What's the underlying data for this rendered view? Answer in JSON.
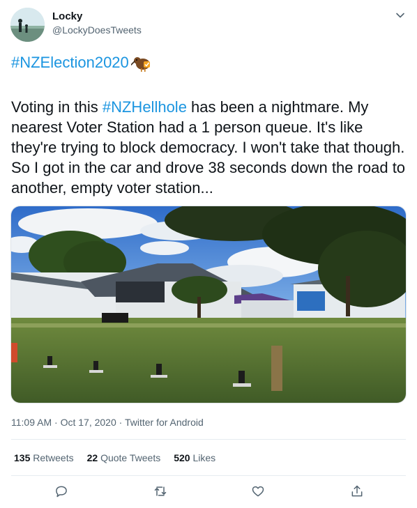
{
  "tweet": {
    "author_name": "Locky",
    "author_handle": "@LockyDoesTweets",
    "hashtag_line": "#NZElection2020",
    "body_pre": "Voting in this ",
    "body_tag": "#NZHellhole",
    "body_post": " has been a nightmare. My nearest Voter Station had a 1 person queue. It's like they're trying to block democracy. I won't take that though. So I got in the car and drove 38 seconds down the road to another, empty voter station...",
    "time": "11:09 AM",
    "date": "Oct 17, 2020",
    "source": "Twitter for Android",
    "sep": "·"
  },
  "stats": {
    "retweets_count": "135",
    "retweets_label": "Retweets",
    "quotes_count": "22",
    "quotes_label": "Quote Tweets",
    "likes_count": "520",
    "likes_label": "Likes"
  },
  "icons": {
    "reply": "reply-icon",
    "retweet": "retweet-icon",
    "like": "heart-icon",
    "share": "share-icon",
    "more": "chevron-down-icon"
  },
  "colors": {
    "link": "#1b95e0",
    "text": "#0f1419",
    "muted": "#536471",
    "icon": "#536471"
  }
}
